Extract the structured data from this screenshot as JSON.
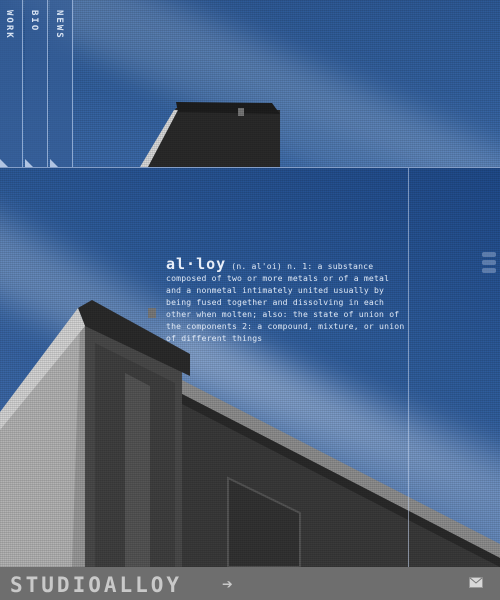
{
  "nav": {
    "tabs": [
      {
        "label": "WORK"
      },
      {
        "label": "BIO"
      },
      {
        "label": "NEWS"
      }
    ]
  },
  "definition": {
    "headword": "al·loy",
    "text": "(n. al'oi) n. 1: a substance composed of two or more metals or of a metal and a nonmetal intimately united usually by being fused together and dissolving in each other when molten; also: the state of union of the components 2: a compound, mixture, or union of different things"
  },
  "footer": {
    "logo": "STUDIOALLOY",
    "logo_arrow_icon": "arrow-right-icon",
    "mail_icon": "mail-icon"
  },
  "colors": {
    "sky": "#2f5a99",
    "footer": "#6e6e6e",
    "text": "#dfe8f5"
  }
}
